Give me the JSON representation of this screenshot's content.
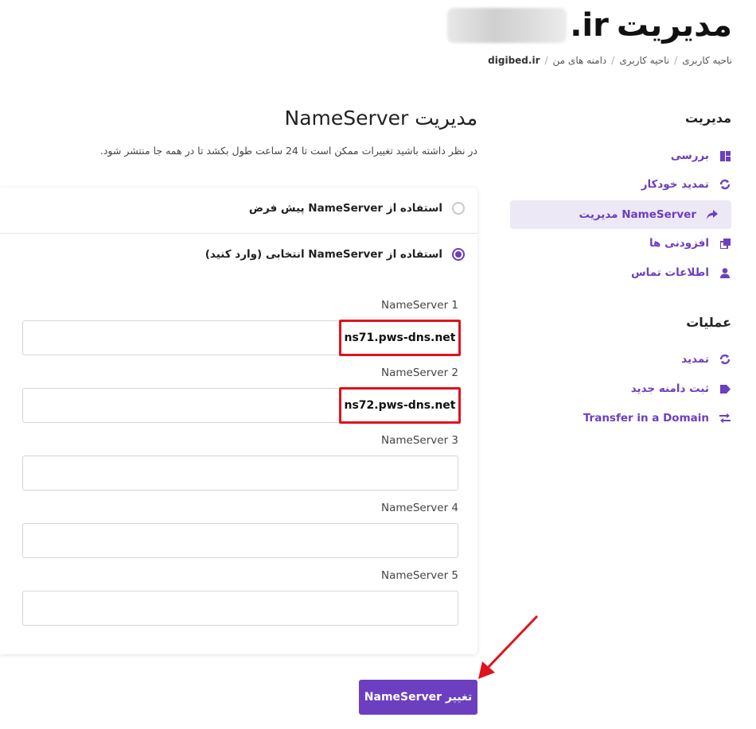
{
  "header": {
    "title_suffix": ".ir",
    "title_word": "مدیریت",
    "breadcrumb": [
      "ناحیه کاربری",
      "ناحیه کاربری",
      "دامنه های من",
      "digibed.ir"
    ]
  },
  "sidebar": {
    "manage_heading": "مدیریت",
    "manage_items": [
      {
        "label": "بررسی",
        "icon": "dashboard-icon"
      },
      {
        "label": "تمدید خودکار",
        "icon": "sync-icon"
      },
      {
        "label": "مدیریت NameServer",
        "icon": "share-arrow-icon",
        "active": true
      },
      {
        "label": "افزودنی ها",
        "icon": "addons-icon"
      },
      {
        "label": "اطلاعات تماس",
        "icon": "user-icon"
      }
    ],
    "ops_heading": "عملیات",
    "ops_items": [
      {
        "label": "تمدید",
        "icon": "renew-icon"
      },
      {
        "label": "ثبت دامنه جدید",
        "icon": "tag-icon"
      },
      {
        "label": "Transfer in a Domain",
        "icon": "transfer-icon"
      }
    ]
  },
  "main": {
    "title": "مدیریت NameServer",
    "note": "در نظر داشته باشید تغییرات ممکن است تا 24 ساعت طول بکشد تا در همه جا منتشر شود.",
    "option_default": "استفاده از NameServer پیش فرض",
    "option_custom": "استفاده از NameServer انتخابی (وارد کنید)",
    "nameservers": [
      {
        "label": "NameServer 1",
        "value": "ns71.pws-dns.net"
      },
      {
        "label": "NameServer 2",
        "value": "ns72.pws-dns.net"
      },
      {
        "label": "NameServer 3",
        "value": ""
      },
      {
        "label": "NameServer 4",
        "value": ""
      },
      {
        "label": "NameServer 5",
        "value": ""
      }
    ],
    "submit_label": "تغییر NameServer"
  },
  "colors": {
    "accent": "#6c3fc0",
    "highlight": "#e0121c"
  }
}
